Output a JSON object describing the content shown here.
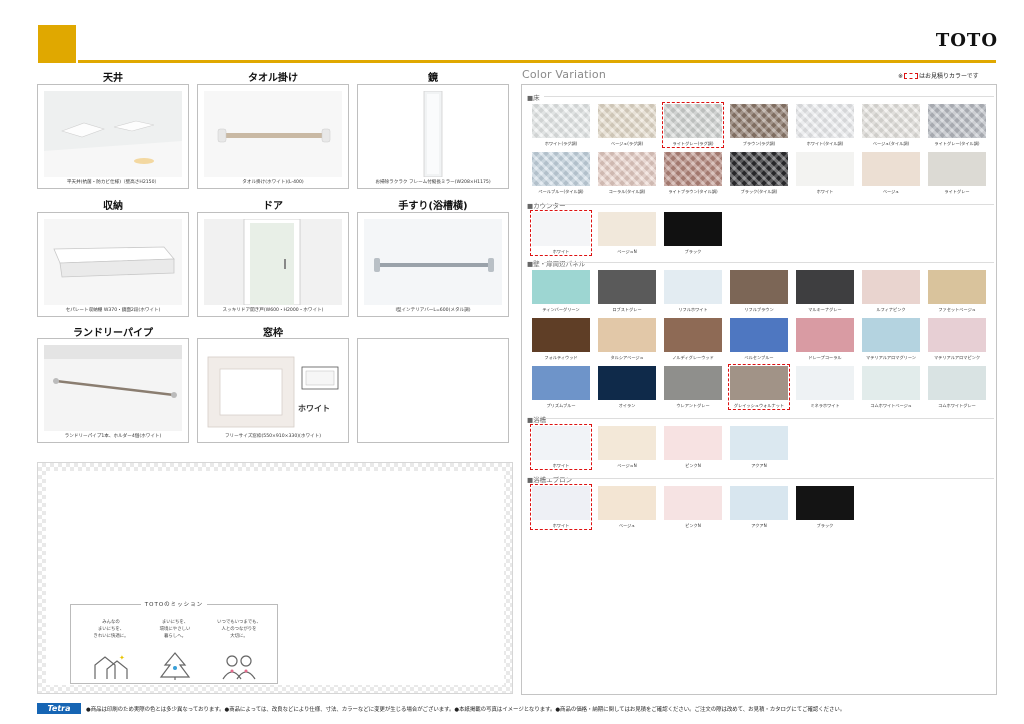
{
  "brand": {
    "name": "TOTO"
  },
  "items": [
    {
      "title": "天井",
      "caption": "平天井(抗菌・防カビ仕様)（壁高さH2150）"
    },
    {
      "title": "タオル掛け",
      "caption": "タオル掛け(ホワイト)(L-400)"
    },
    {
      "title": "鏡",
      "caption": "お掃除ラクラク フレーム付縦長ミラー(W208×H1175)"
    },
    {
      "title": "収納",
      "caption": "セパレート収納棚 W370・鏡面2段(ホワイト)"
    },
    {
      "title": "ドア",
      "caption": "スッキリドア開き戸(W600・H2000・ホワイト)"
    },
    {
      "title": "手すり(浴槽横)",
      "caption": "I型インテリアバーL=600(メタル調)"
    },
    {
      "title": "ランドリーパイプ",
      "caption": "ランドリーパイプ1本、ホルダー4個(ホワイト)"
    },
    {
      "title": "窓枠",
      "caption": "フリーサイズ窓枠(550×910×330)(ホワイト)",
      "badge": "ホワイト"
    }
  ],
  "mission": {
    "title": "TOTOのミッション",
    "columns": [
      {
        "lines": [
          "みんなの",
          "まいにちを、",
          "きれいに快適に。"
        ]
      },
      {
        "lines": [
          "まいにちを、",
          "環境にやさしい",
          "暮らしへ。"
        ]
      },
      {
        "lines": [
          "いつでもいつまでも、",
          "人とのつながりを",
          "大切に。"
        ]
      }
    ]
  },
  "color_variation": {
    "title": "Color Variation",
    "note_prefix": "※",
    "note_suffix": "はお見積りカラーです",
    "sections": [
      {
        "label": "■床",
        "swatches": [
          {
            "label": "ホワイト(ラグ調)",
            "color": "#e9ecec"
          },
          {
            "label": "ベージュ(ラグ調)",
            "color": "#e6dccb"
          },
          {
            "label": "ライトグレー(ラグ調)",
            "color": "#d3d6d4",
            "recommended": true
          },
          {
            "label": "ブラウン(ラグ調)",
            "color": "#8e7a6c"
          },
          {
            "label": "ホワイト(タイル調)",
            "color": "#eeeff2"
          },
          {
            "label": "ベージュ(タイル調)",
            "color": "#e8e6e2"
          },
          {
            "label": "ライトグレー(タイル調)",
            "color": "#b9bdc4"
          },
          {
            "label": "ペールブルー(タイル調)",
            "color": "#c7d7e3"
          },
          {
            "label": "コーラル(タイル調)",
            "color": "#e8cfc6"
          },
          {
            "label": "ライトブラウン(タイル調)",
            "color": "#b5877c"
          },
          {
            "label": "ブラック(タイル調)",
            "color": "#2b2b2e"
          },
          {
            "label": "ホワイト",
            "color": "#f3f3f1"
          },
          {
            "label": "ベージュ",
            "color": "#ecdfd3"
          },
          {
            "label": "ライトグレー",
            "color": "#dcdad4"
          }
        ]
      },
      {
        "label": "■カウンター",
        "swatches": [
          {
            "label": "ホワイト",
            "color": "#f4f5f7",
            "recommended": true
          },
          {
            "label": "ベージュN",
            "color": "#f1e8db"
          },
          {
            "label": "ブラック",
            "color": "#111111"
          }
        ]
      },
      {
        "label": "■壁・扉周辺パネル",
        "swatches": [
          {
            "label": "ティンバーグリーン",
            "color": "#9dd6d2"
          },
          {
            "label": "ロブストグレー",
            "color": "#5a5a5a"
          },
          {
            "label": "リフルホワイト",
            "color": "#e3ecf2"
          },
          {
            "label": "リフルブラウン",
            "color": "#7c6656"
          },
          {
            "label": "マルキーナグレー",
            "color": "#3e3e40"
          },
          {
            "label": "ルフィナピンク",
            "color": "#e9d4cf"
          },
          {
            "label": "ファセットベージュ",
            "color": "#d9c39c"
          },
          {
            "label": "フォルティウッド",
            "color": "#5f3e26"
          },
          {
            "label": "タルシアベージュ",
            "color": "#e2c8a8"
          },
          {
            "label": "ノルディグレーウッド",
            "color": "#8e6a55"
          },
          {
            "label": "ベルセンブルー",
            "color": "#4e77c1"
          },
          {
            "label": "ドレープコーラル",
            "color": "#d99ba3"
          },
          {
            "label": "マテリアルアロマグリーン",
            "color": "#b4d3e0"
          },
          {
            "label": "マテリアルアロマピンク",
            "color": "#e7cfd4"
          },
          {
            "label": "プリズムブルー",
            "color": "#6e94c9"
          },
          {
            "label": "オイラン",
            "color": "#0f2a4a"
          },
          {
            "label": "ウレアントグレー",
            "color": "#8f8f8c"
          },
          {
            "label": "グレイッシュウォルナット",
            "color": "#a19387",
            "recommended": true
          },
          {
            "label": "ミネラホワイト",
            "color": "#eef2f4"
          },
          {
            "label": "コムホワイトベージュ",
            "color": "#e2eceb"
          },
          {
            "label": "コムホワイトグレー",
            "color": "#d9e3e3"
          }
        ]
      },
      {
        "label": "■浴槽",
        "swatches": [
          {
            "label": "ホワイト",
            "color": "#f1f3f7",
            "recommended": true
          },
          {
            "label": "ベージュN",
            "color": "#f3e8d8"
          },
          {
            "label": "ピンクN",
            "color": "#f7e2e2"
          },
          {
            "label": "アクアN",
            "color": "#dbe8f0"
          }
        ]
      },
      {
        "label": "■浴槽エプロン",
        "swatches": [
          {
            "label": "ホワイト",
            "color": "#eef0f5",
            "recommended": true
          },
          {
            "label": "ベージュ",
            "color": "#f3e5d3"
          },
          {
            "label": "ピンクN",
            "color": "#f6e3e3"
          },
          {
            "label": "アクアN",
            "color": "#d8e6ef"
          },
          {
            "label": "ブラック",
            "color": "#141414"
          }
        ]
      }
    ]
  },
  "footer": {
    "logo": "Tetra",
    "notice": "●商品は印刷のため実際の色とは多少異なっております。●商品によっては、改良などにより仕様、寸法、カラーなどに変更が生じる場合がございます。●本紙掲載の写真はイメージとなります。●商品の価格・納期に関してはお見積をご確認ください。ご注文の際は改めて、お見積・カタログにてご確認ください。"
  },
  "colors": {
    "accent": "#e0a800",
    "recommend_dash": "#dd1111",
    "footer_logo_bg": "#1665b4"
  }
}
